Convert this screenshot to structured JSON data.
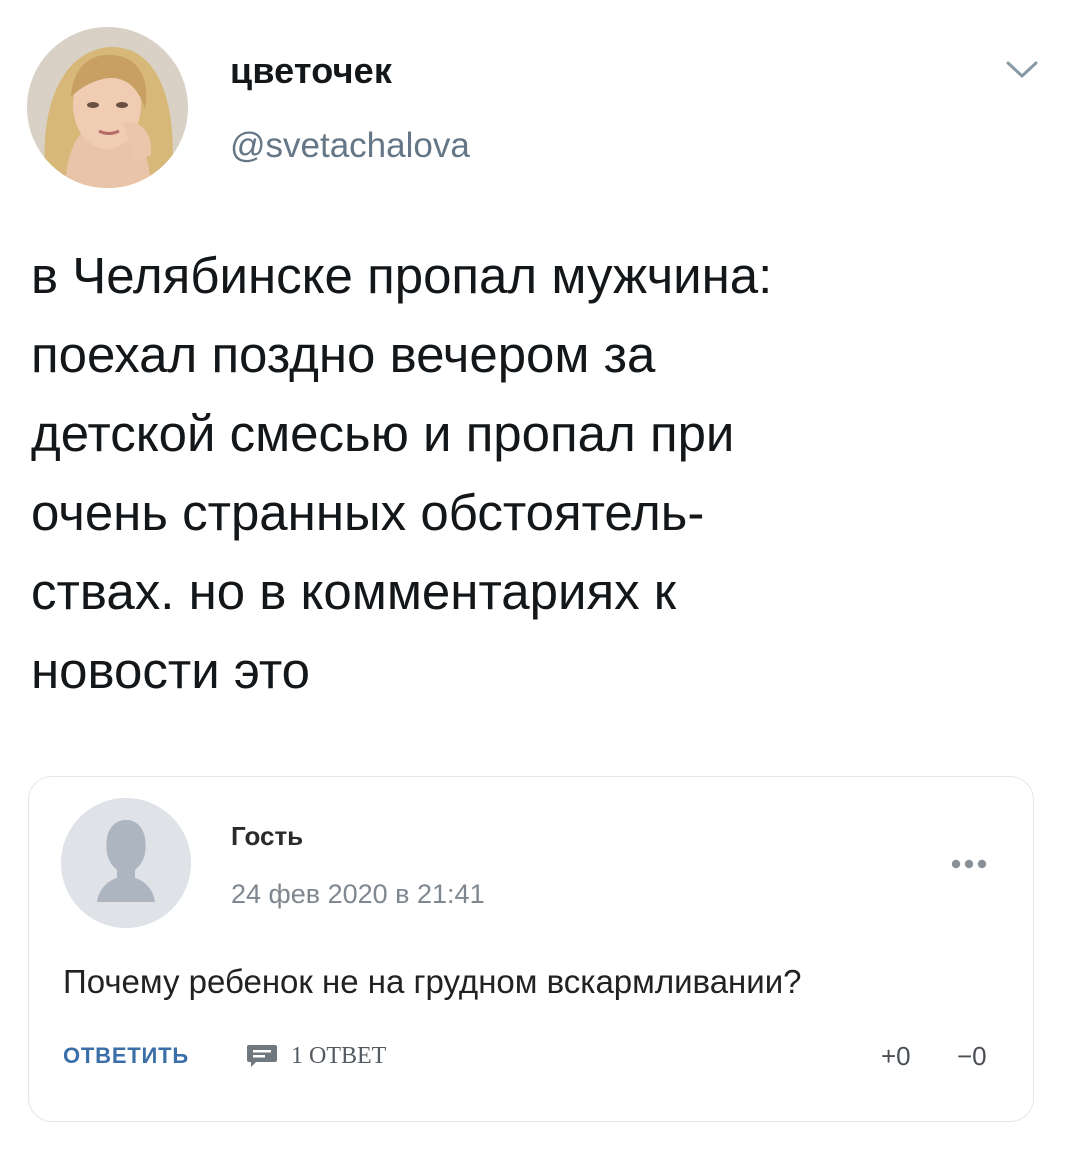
{
  "tweet": {
    "display_name": "цветочек",
    "handle": "@svetachalova",
    "text": "в Челябинске пропал мужчина:\nпоехал поздно вечером за\nдетской смесью и пропал при\nочень странных обстоятель-\nствах. но в комментариях к\nновости это"
  },
  "comment": {
    "author": "Гость",
    "date": "24 фев 2020 в 21:41",
    "text": "Почему ребенок не на грудном вскармливании?",
    "reply_label": "ОТВЕТИТЬ",
    "replies_label": "1 ОТВЕТ",
    "upvotes": "+0",
    "downvotes": "−0"
  },
  "icons": {
    "tweet_menu": "chevron-down-icon",
    "comment_menu": "more-dots-icon",
    "replies": "speech-bubble-icon",
    "comment_avatar": "default-user-silhouette"
  },
  "colors": {
    "handle": "#657786",
    "link": "#3a6fa8",
    "border": "#e1e8ed"
  }
}
